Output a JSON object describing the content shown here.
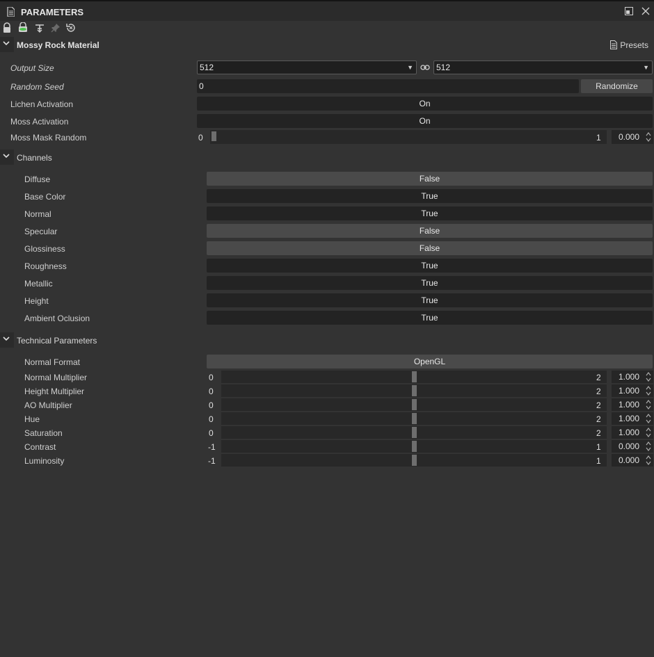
{
  "panel": {
    "title": "PARAMETERS"
  },
  "material": {
    "title": "Mossy Rock Material",
    "presets_label": "Presets"
  },
  "params": {
    "output_size": {
      "label": "Output Size",
      "value_a": "512",
      "value_b": "512"
    },
    "random_seed": {
      "label": "Random Seed",
      "value": "0",
      "button": "Randomize"
    },
    "lichen_activation": {
      "label": "Lichen Activation",
      "value": "On"
    },
    "moss_activation": {
      "label": "Moss Activation",
      "value": "On"
    },
    "moss_mask_random": {
      "label": "Moss Mask Random",
      "min": "0",
      "max": "1",
      "value": "0.000",
      "fraction": 0.0
    }
  },
  "channels": {
    "title": "Channels",
    "items": [
      {
        "label": "Diffuse",
        "value": "False"
      },
      {
        "label": "Base Color",
        "value": "True"
      },
      {
        "label": "Normal",
        "value": "True"
      },
      {
        "label": "Specular",
        "value": "False"
      },
      {
        "label": "Glossiness",
        "value": "False"
      },
      {
        "label": "Roughness",
        "value": "True"
      },
      {
        "label": "Metallic",
        "value": "True"
      },
      {
        "label": "Height",
        "value": "True"
      },
      {
        "label": "Ambient Oclusion",
        "value": "True"
      }
    ]
  },
  "technical": {
    "title": "Technical Parameters",
    "normal_format": {
      "label": "Normal Format",
      "value": "OpenGL"
    },
    "sliders": [
      {
        "label": "Normal Multiplier",
        "min": "0",
        "max": "2",
        "value": "1.000",
        "fraction": 0.5
      },
      {
        "label": "Height Multiplier",
        "min": "0",
        "max": "2",
        "value": "1.000",
        "fraction": 0.5
      },
      {
        "label": "AO Multiplier",
        "min": "0",
        "max": "2",
        "value": "1.000",
        "fraction": 0.5
      },
      {
        "label": "Hue",
        "min": "0",
        "max": "2",
        "value": "1.000",
        "fraction": 0.5
      },
      {
        "label": "Saturation",
        "min": "0",
        "max": "2",
        "value": "1.000",
        "fraction": 0.5
      },
      {
        "label": "Contrast",
        "min": "-1",
        "max": "1",
        "value": "0.000",
        "fraction": 0.5
      },
      {
        "label": "Luminosity",
        "min": "-1",
        "max": "1",
        "value": "0.000",
        "fraction": 0.5
      }
    ]
  },
  "colors": {
    "background": "#333333",
    "field_dark": "#232323",
    "field_false": "#4a4a4a",
    "accent_green": "#4cc24c"
  },
  "icons": {
    "toolbar": [
      "lock-icon",
      "sync-icon",
      "hierarchy-icon",
      "pin-icon",
      "reset-icon"
    ]
  }
}
